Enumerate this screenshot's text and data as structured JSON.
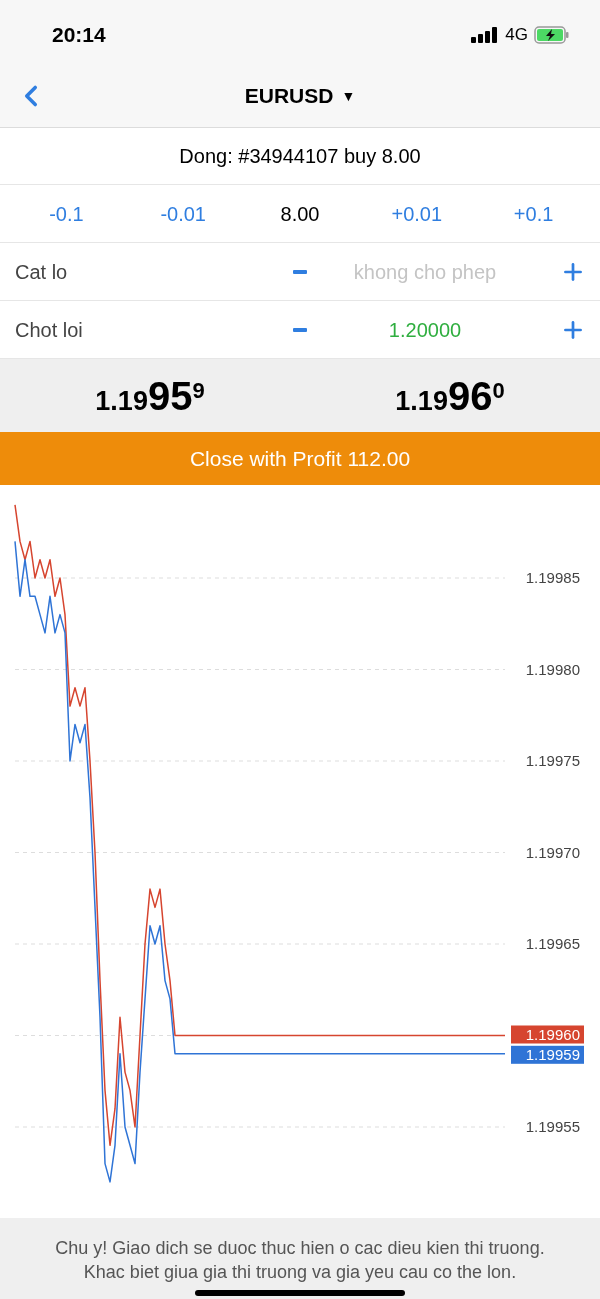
{
  "status_bar": {
    "time": "20:14",
    "network": "4G"
  },
  "nav": {
    "title": "EURUSD",
    "caret": "▼"
  },
  "order_header": "Dong: #34944107 buy 8.00",
  "volume_row": [
    {
      "kind": "step",
      "text": "-0.1"
    },
    {
      "kind": "step",
      "text": "-0.01"
    },
    {
      "kind": "value",
      "text": "8.00"
    },
    {
      "kind": "step",
      "text": "+0.01"
    },
    {
      "kind": "step",
      "text": "+0.1"
    }
  ],
  "levels": [
    {
      "label": "Cat lo",
      "placeholder": "khong cho phep"
    },
    {
      "label": "Chot loi",
      "value": "1.20000"
    }
  ],
  "prices": [
    {
      "prefix": "1.19",
      "big": "95",
      "sup": "9"
    },
    {
      "prefix": "1.19",
      "big": "96",
      "sup": "0"
    }
  ],
  "close_button": "Close with Profit 112.00",
  "chart_data": {
    "type": "line",
    "grid": true,
    "categories": [
      null,
      null,
      null,
      null,
      null,
      null,
      null,
      null,
      null,
      null,
      null,
      null,
      null,
      null,
      null,
      null,
      null,
      null,
      null,
      null,
      null,
      null,
      null,
      null,
      null,
      null,
      null,
      null,
      null,
      null,
      null,
      null,
      null,
      null,
      null,
      null,
      null,
      null,
      null,
      null,
      null,
      null,
      null,
      null,
      null,
      null,
      null,
      null,
      null,
      null,
      null,
      null,
      null,
      null,
      null,
      null,
      null,
      null,
      null,
      null,
      null,
      null,
      null,
      null,
      null,
      null,
      null,
      null,
      null,
      null,
      null,
      null,
      null,
      null,
      null,
      null,
      null,
      null,
      null,
      null,
      null,
      null,
      null,
      null,
      null,
      null,
      null,
      null,
      null,
      null,
      null,
      null,
      null,
      null,
      null,
      null,
      null,
      null,
      null
    ],
    "ylim": [
      1.1995,
      1.1999
    ],
    "yticks": [
      {
        "value": 1.19985,
        "label": "1.19985"
      },
      {
        "value": 1.1998,
        "label": "1.19980"
      },
      {
        "value": 1.19975,
        "label": "1.19975"
      },
      {
        "value": 1.1997,
        "label": "1.19970"
      },
      {
        "value": 1.19965,
        "label": "1.19965"
      },
      {
        "value": 1.19955,
        "label": "1.19955"
      }
    ],
    "series": [
      {
        "color": "#d6452f",
        "values": [
          1.19989,
          1.19987,
          1.19986,
          1.19987,
          1.19985,
          1.19986,
          1.19985,
          1.19986,
          1.19984,
          1.19985,
          1.19983,
          1.19978,
          1.19979,
          1.19978,
          1.19979,
          1.19975,
          1.1997,
          1.19963,
          1.19957,
          1.19954,
          1.19956,
          1.19961,
          1.19958,
          1.19957,
          1.19955,
          1.1996,
          1.19965,
          1.19968,
          1.19967,
          1.19968,
          1.19965,
          1.19963,
          1.1996,
          1.1996,
          1.1996,
          1.1996,
          1.1996,
          1.1996,
          1.1996,
          1.1996,
          1.1996,
          1.1996,
          1.1996,
          1.1996,
          1.1996,
          1.1996,
          1.1996,
          1.1996,
          1.1996,
          1.1996,
          1.1996,
          1.1996,
          1.1996,
          1.1996,
          1.1996,
          1.1996,
          1.1996,
          1.1996,
          1.1996,
          1.1996,
          1.1996,
          1.1996,
          1.1996,
          1.1996,
          1.1996,
          1.1996,
          1.1996,
          1.1996,
          1.1996,
          1.1996,
          1.1996,
          1.1996,
          1.1996,
          1.1996,
          1.1996,
          1.1996,
          1.1996,
          1.1996,
          1.1996,
          1.1996,
          1.1996,
          1.1996,
          1.1996,
          1.1996,
          1.1996,
          1.1996,
          1.1996,
          1.1996,
          1.1996,
          1.1996,
          1.1996,
          1.1996,
          1.1996,
          1.1996,
          1.1996,
          1.1996,
          1.1996,
          1.1996,
          1.1996
        ]
      },
      {
        "color": "#2f74d6",
        "values": [
          1.19987,
          1.19984,
          1.19986,
          1.19984,
          1.19984,
          1.19983,
          1.19982,
          1.19984,
          1.19982,
          1.19983,
          1.19982,
          1.19975,
          1.19977,
          1.19976,
          1.19977,
          1.19973,
          1.19967,
          1.19961,
          1.19953,
          1.19952,
          1.19954,
          1.19959,
          1.19955,
          1.19954,
          1.19953,
          1.19958,
          1.19962,
          1.19966,
          1.19965,
          1.19966,
          1.19963,
          1.19962,
          1.19959,
          1.19959,
          1.19959,
          1.19959,
          1.19959,
          1.19959,
          1.19959,
          1.19959,
          1.19959,
          1.19959,
          1.19959,
          1.19959,
          1.19959,
          1.19959,
          1.19959,
          1.19959,
          1.19959,
          1.19959,
          1.19959,
          1.19959,
          1.19959,
          1.19959,
          1.19959,
          1.19959,
          1.19959,
          1.19959,
          1.19959,
          1.19959,
          1.19959,
          1.19959,
          1.19959,
          1.19959,
          1.19959,
          1.19959,
          1.19959,
          1.19959,
          1.19959,
          1.19959,
          1.19959,
          1.19959,
          1.19959,
          1.19959,
          1.19959,
          1.19959,
          1.19959,
          1.19959,
          1.19959,
          1.19959,
          1.19959,
          1.19959,
          1.19959,
          1.19959,
          1.19959,
          1.19959,
          1.19959,
          1.19959,
          1.19959,
          1.19959,
          1.19959,
          1.19959,
          1.19959,
          1.19959,
          1.19959,
          1.19959,
          1.19959,
          1.19959,
          1.19959
        ]
      }
    ]
  },
  "price_tags": [
    {
      "text": "1.19960",
      "color": "#d6452f"
    },
    {
      "text": "1.19959",
      "color": "#2f74d6"
    }
  ],
  "footer": "Chu y! Giao dich se duoc thuc hien o cac dieu kien thi truong. Khac biet giua gia thi truong va gia yeu cau co the lon."
}
